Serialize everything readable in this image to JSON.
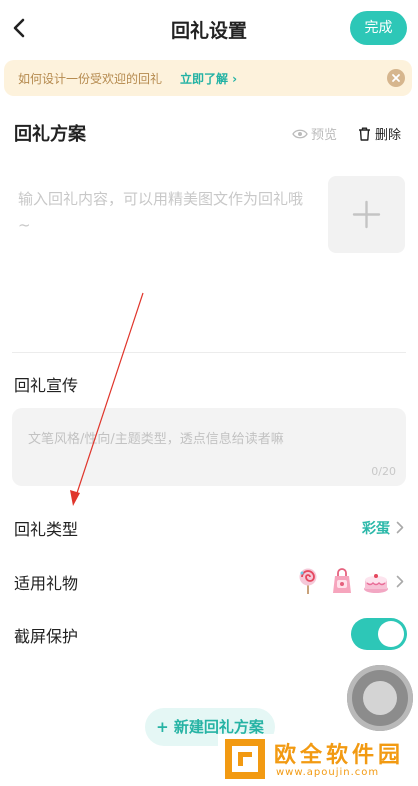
{
  "header": {
    "title": "回礼设置",
    "done_label": "完成"
  },
  "notice": {
    "text": "如何设计一份受欢迎的回礼",
    "link": "立即了解 ›"
  },
  "plan_section": {
    "title": "回礼方案",
    "preview_label": "预览",
    "delete_label": "删除",
    "content_placeholder": "输入回礼内容，可以用精美图文作为回礼哦~"
  },
  "promo": {
    "title": "回礼宣传",
    "placeholder": "文笔风格/性向/主题类型，透点信息给读者嘛",
    "counter": "0/20"
  },
  "settings": {
    "type_label": "回礼类型",
    "type_value": "彩蛋",
    "gift_label": "适用礼物",
    "gifts": [
      "lollipop-icon",
      "gift-bag-icon",
      "cake-icon"
    ],
    "screenshot_label": "截屏保护",
    "screenshot_protection_on": true
  },
  "footer": {
    "new_plan_label": "+ 新建回礼方案"
  },
  "watermark": {
    "title": "欧全软件园",
    "url": "www.apoujin.com"
  },
  "colors": {
    "accent": "#2dc7b7",
    "notice_bg": "#fdf2dc",
    "notice_text": "#b58a4e",
    "annotation": "#e0352b",
    "watermark": "#f29a12"
  }
}
